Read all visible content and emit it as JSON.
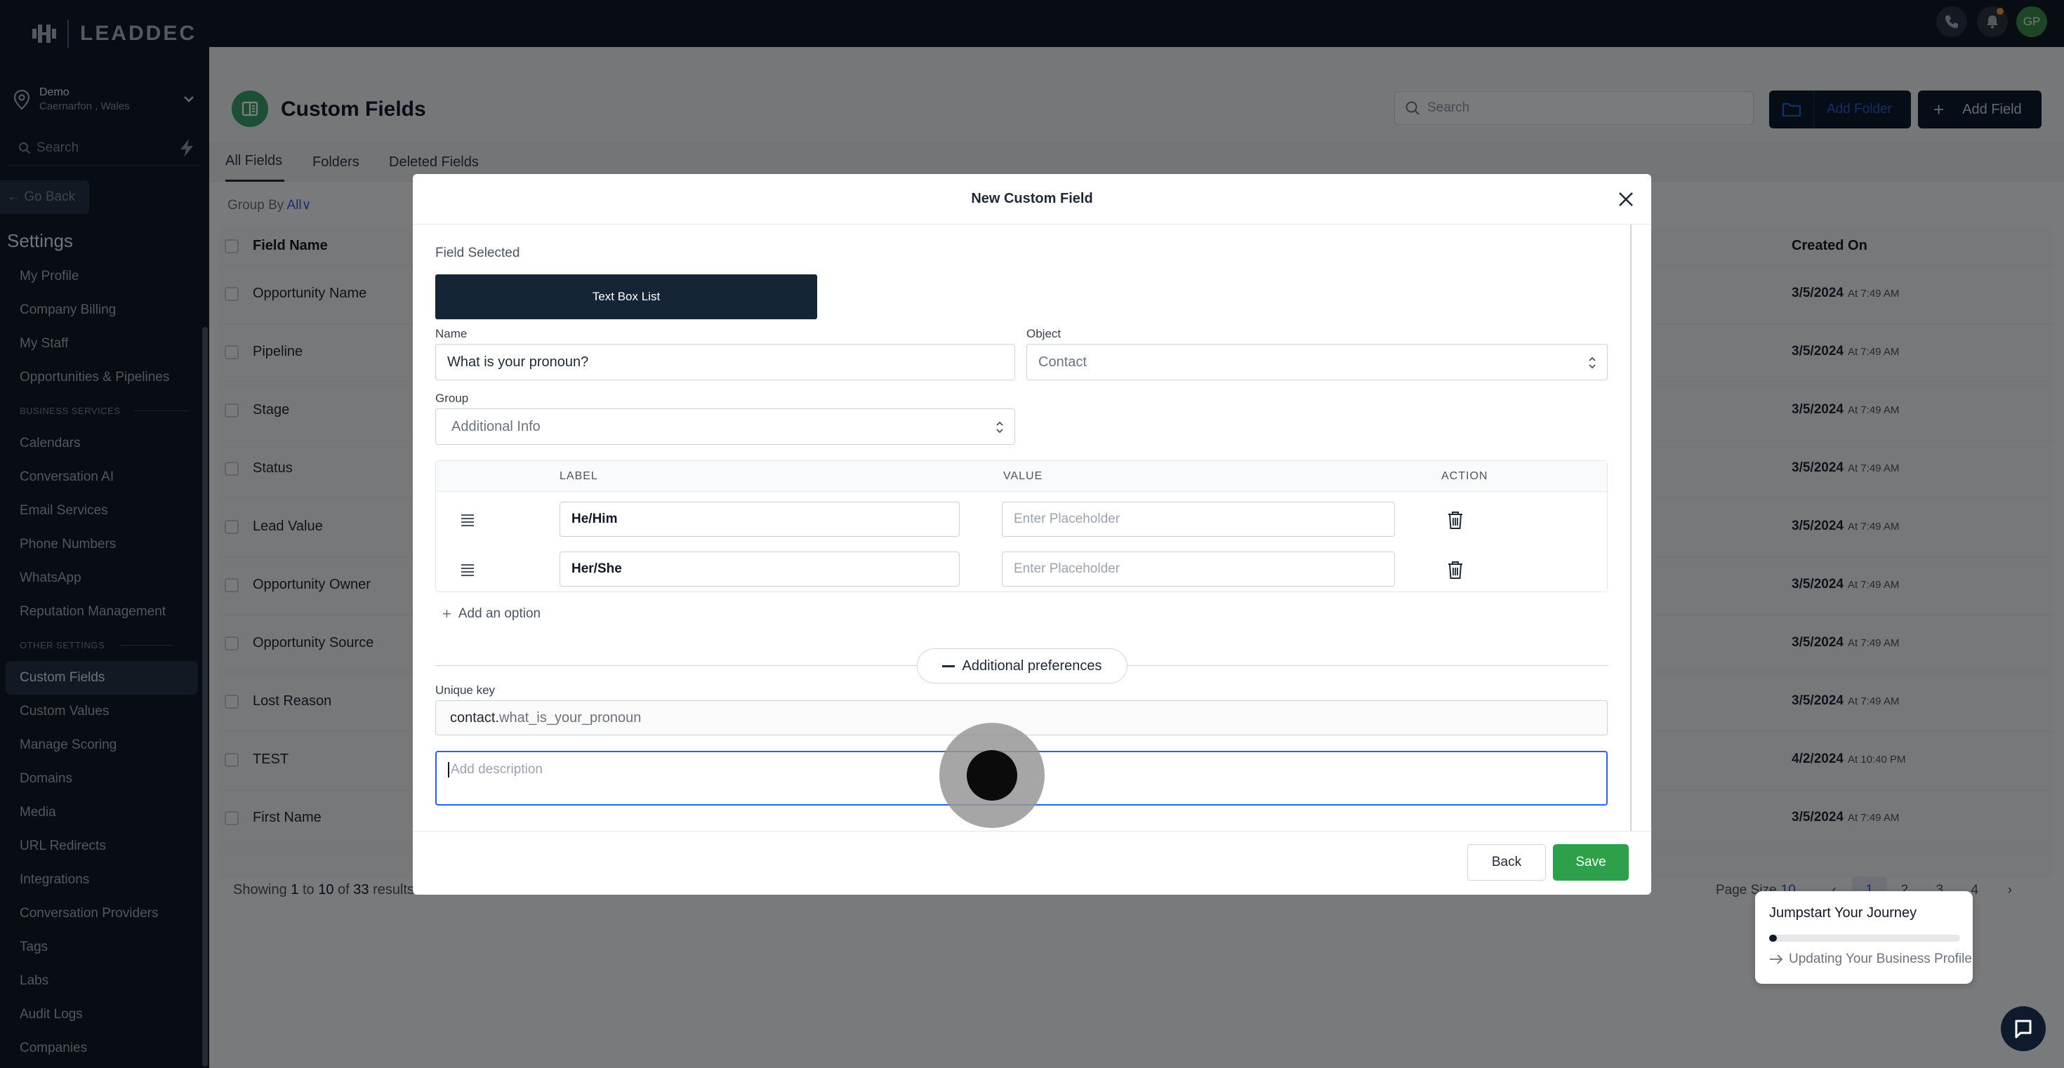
{
  "brand": {
    "name": "LEADDEC"
  },
  "location": {
    "name": "Demo",
    "address": "Caernarfon , Wales"
  },
  "sidebar": {
    "search_placeholder": "Search",
    "go_back": "Go Back",
    "settings_title": "Settings",
    "items_top": [
      "My Profile",
      "Company Billing",
      "My Staff",
      "Opportunities & Pipelines"
    ],
    "section_business": "BUSINESS SERVICES",
    "items_business": [
      "Calendars",
      "Conversation AI",
      "Email Services",
      "Phone Numbers",
      "WhatsApp",
      "Reputation Management"
    ],
    "section_other": "OTHER SETTINGS",
    "items_other": [
      "Custom Fields",
      "Custom Values",
      "Manage Scoring",
      "Domains",
      "Media",
      "URL Redirects",
      "Integrations",
      "Conversation Providers",
      "Tags",
      "Labs",
      "Audit Logs",
      "Companies"
    ]
  },
  "topbar": {
    "avatar_initials": "GP"
  },
  "page": {
    "title": "Custom Fields",
    "search_placeholder": "Search",
    "add_folder": "Add Folder",
    "add_field": "Add Field",
    "tabs": [
      "All Fields",
      "Folders",
      "Deleted Fields"
    ],
    "group_by_label": "Group By",
    "group_by_value": "All"
  },
  "table": {
    "col_name": "Field Name",
    "col_created": "Created On",
    "rows": [
      {
        "name": "Opportunity Name",
        "date": "3/5/2024",
        "time": "At 7:49 AM"
      },
      {
        "name": "Pipeline",
        "date": "3/5/2024",
        "time": "At 7:49 AM"
      },
      {
        "name": "Stage",
        "date": "3/5/2024",
        "time": "At 7:49 AM"
      },
      {
        "name": "Status",
        "date": "3/5/2024",
        "time": "At 7:49 AM"
      },
      {
        "name": "Lead Value",
        "date": "3/5/2024",
        "time": "At 7:49 AM"
      },
      {
        "name": "Opportunity Owner",
        "date": "3/5/2024",
        "time": "At 7:49 AM"
      },
      {
        "name": "Opportunity Source",
        "date": "3/5/2024",
        "time": "At 7:49 AM"
      },
      {
        "name": "Lost Reason",
        "date": "3/5/2024",
        "time": "At 7:49 AM"
      },
      {
        "name": "TEST",
        "date": "4/2/2024",
        "time": "At 10:40 PM"
      },
      {
        "name": "First Name",
        "date": "3/5/2024",
        "time": "At 7:49 AM"
      }
    ],
    "showing_prefix": "Showing",
    "showing_from": "1",
    "showing_to_word": "to",
    "showing_to": "10",
    "showing_of_word": "of",
    "showing_total": "33",
    "showing_suffix": "results",
    "page_size_label": "Page Size",
    "page_size_value": "10",
    "pages": [
      "1",
      "2",
      "3",
      "4"
    ]
  },
  "modal": {
    "title": "New Custom Field",
    "field_selected_label": "Field Selected",
    "field_type": "Text Box List",
    "name_label": "Name",
    "name_value": "What is your pronoun?",
    "object_label": "Object",
    "object_value": "Contact",
    "group_label": "Group",
    "group_value": "Additional Info",
    "options_headers": {
      "label": "LABEL",
      "value": "VALUE",
      "action": "ACTION"
    },
    "options": [
      {
        "label": "He/Him",
        "value_placeholder": "Enter Placeholder"
      },
      {
        "label": "Her/She",
        "value_placeholder": "Enter Placeholder"
      }
    ],
    "add_option": "Add an option",
    "additional_preferences": "Additional preferences",
    "unique_key_label": "Unique key",
    "unique_key_prefix": "contact.",
    "unique_key_value": "what_is_your_pronoun",
    "description_placeholder": "Add description",
    "back": "Back",
    "save": "Save"
  },
  "journey": {
    "title": "Jumpstart Your Journey",
    "progress": 0.04,
    "step": "Updating Your Business Profile"
  }
}
